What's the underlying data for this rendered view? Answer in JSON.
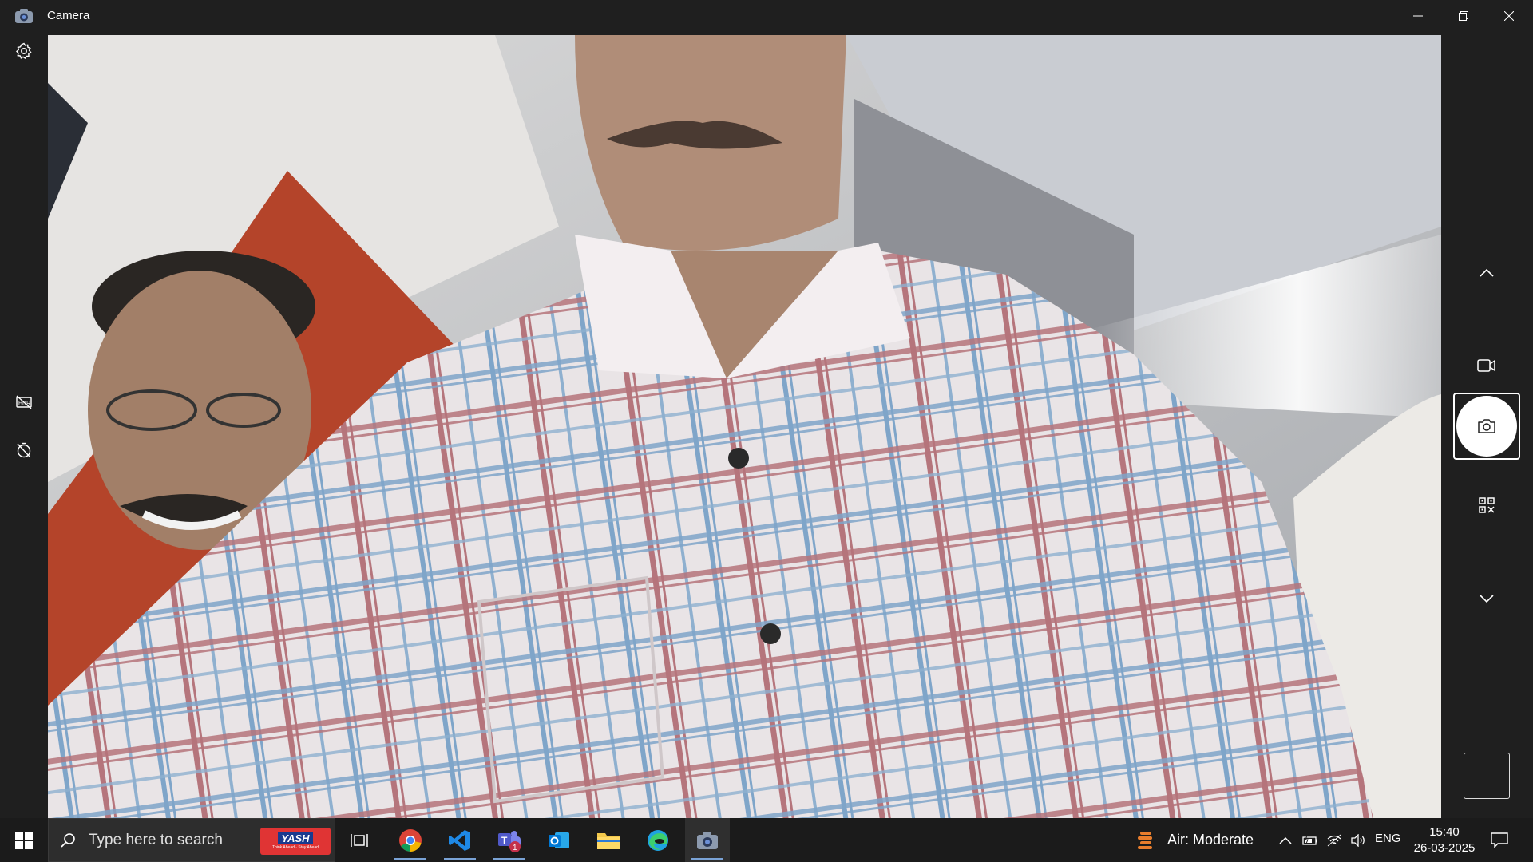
{
  "window": {
    "title": "Camera",
    "icons": [
      "camera-app-icon",
      "minimize-icon",
      "restore-icon",
      "close-icon"
    ]
  },
  "left_rail": {
    "icons": [
      "settings-icon",
      "hdr-off-icon",
      "timer-off-icon"
    ]
  },
  "right_rail": {
    "icons": [
      "chevron-up-icon",
      "video-mode-icon",
      "photo-capture-icon",
      "qr-scan-icon",
      "chevron-down-icon"
    ],
    "selected_mode": "photo"
  },
  "taskbar": {
    "search_placeholder": "Type here to search",
    "search_logo": {
      "main": "YASH",
      "sub": "Think Ahead · Stay Ahead"
    },
    "apps": [
      "task-view-icon",
      "chrome-icon",
      "vscode-icon",
      "teams-icon",
      "outlook-icon",
      "file-explorer-icon",
      "edge-icon",
      "camera-icon"
    ],
    "teams_badge": "1",
    "active_app": "camera",
    "weather": "Air: Moderate",
    "language": "ENG",
    "time": "15:40",
    "date": "26-03-2025"
  },
  "colors": {
    "background": "#1f1f1f",
    "taskbar": "#1b1b1b",
    "accent_underline": "#7aa3d6"
  }
}
